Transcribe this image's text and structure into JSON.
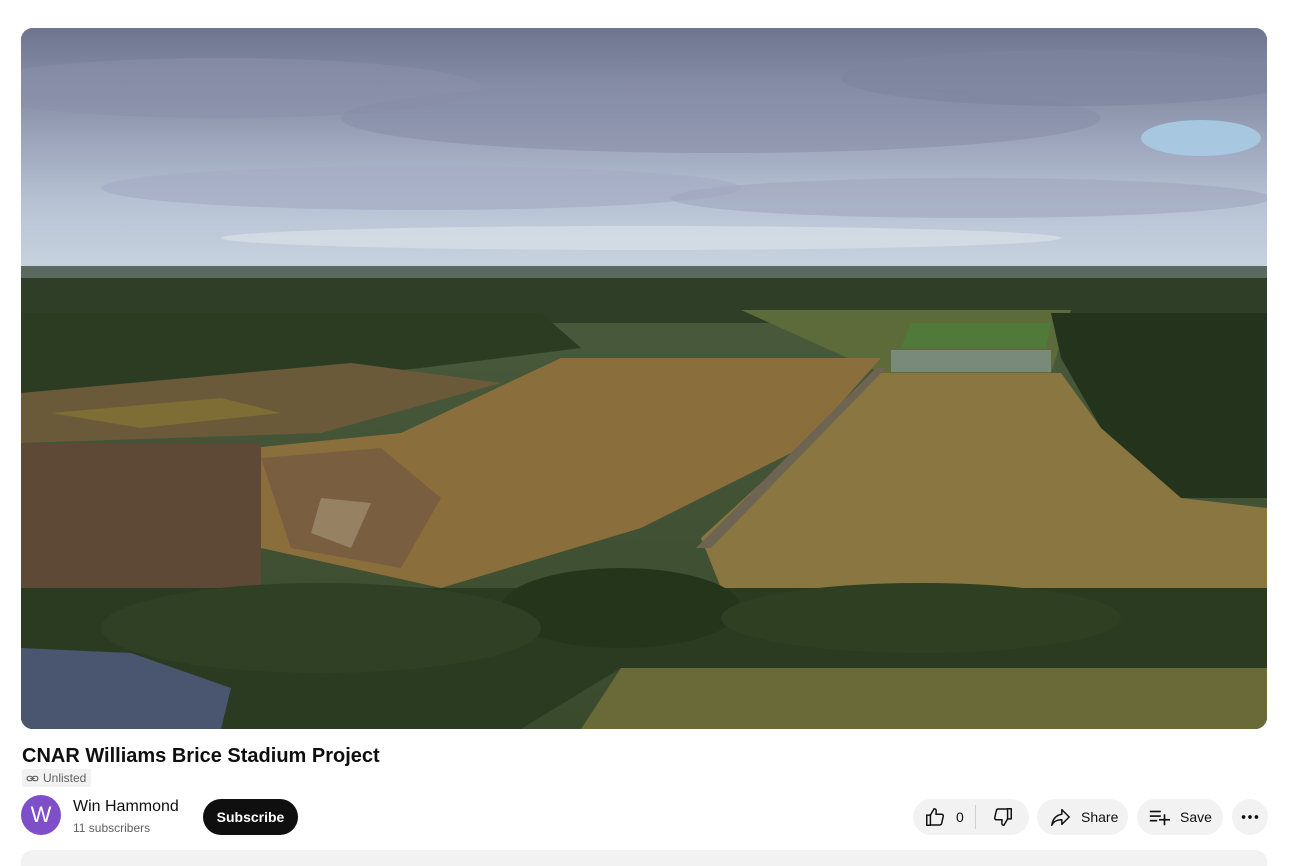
{
  "video": {
    "title": "CNAR Williams Brice Stadium Project",
    "visibility": "Unlisted",
    "thumbnail_icon": "aerial-landscape-frame"
  },
  "channel": {
    "avatar_letter": "W",
    "avatar_color": "#7e4fc9",
    "name": "Win Hammond",
    "subscribers": "11 subscribers",
    "subscribe_label": "Subscribe"
  },
  "actions": {
    "like_count": "0",
    "share_label": "Share",
    "save_label": "Save"
  },
  "icons": {
    "visibility": "link-icon",
    "like": "thumbs-up-icon",
    "dislike": "thumbs-down-icon",
    "share": "share-arrow-icon",
    "save": "playlist-add-icon",
    "more": "more-horizontal-icon"
  }
}
